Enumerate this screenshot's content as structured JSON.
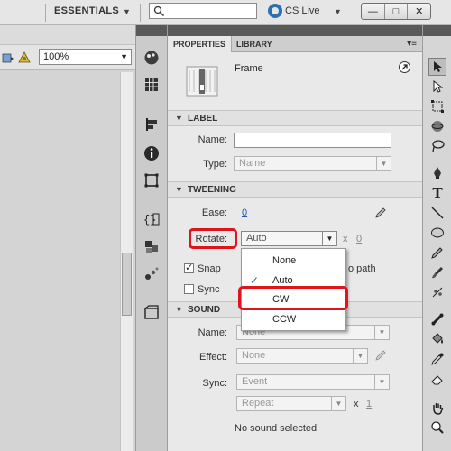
{
  "app": {
    "workspace_label": "ESSENTIALS",
    "cs_live_label": "CS Live",
    "window_buttons": [
      "—",
      "□",
      "✕"
    ]
  },
  "document": {
    "zoom_value": "100%"
  },
  "properties_panel": {
    "tabs": [
      "PROPERTIES",
      "LIBRARY"
    ],
    "frame_label": "Frame",
    "label_section": {
      "title": "LABEL",
      "name_label": "Name:",
      "name_value": "",
      "type_label": "Type:",
      "type_value": "Name"
    },
    "tweening_section": {
      "title": "TWEENING",
      "ease_label": "Ease:",
      "ease_value": "0",
      "rotate_label": "Rotate:",
      "rotate_value": "Auto",
      "rotate_multiplier": "x",
      "rotate_count": "0",
      "snap_label": "Snap",
      "snap_checked": true,
      "orient_partial": "o path",
      "sync_label": "Sync",
      "sync_checked": false
    },
    "sound_section": {
      "title": "SOUND",
      "name_label": "Name:",
      "name_value": "None",
      "effect_label": "Effect:",
      "effect_value": "None",
      "sync_label": "Sync:",
      "sync_value": "Event",
      "repeat_value": "Repeat",
      "repeat_multiplier": "x",
      "repeat_count": "1",
      "status": "No sound selected"
    }
  },
  "rotate_menu": {
    "options": [
      "None",
      "Auto",
      "CW",
      "CCW"
    ],
    "checked_option": "Auto",
    "highlighted_option": "CW"
  },
  "colors": {
    "highlight": "#e0141c",
    "link": "#2457b0",
    "panel_header": "#595959"
  }
}
